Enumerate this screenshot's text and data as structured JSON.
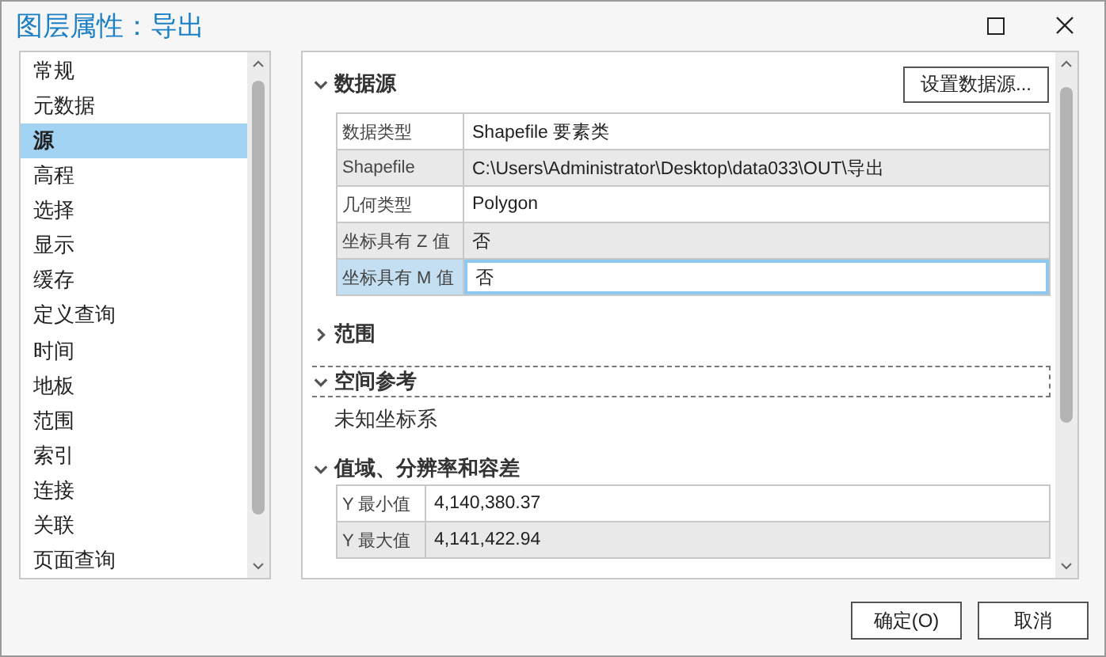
{
  "window": {
    "title": "图层属性：导出"
  },
  "sidebar": {
    "items": [
      {
        "label": "常规",
        "selected": false
      },
      {
        "label": "元数据",
        "selected": false
      },
      {
        "label": "源",
        "selected": true
      },
      {
        "label": "高程",
        "selected": false
      },
      {
        "label": "选择",
        "selected": false
      },
      {
        "label": "显示",
        "selected": false
      },
      {
        "label": "缓存",
        "selected": false
      },
      {
        "label": "定义查询",
        "selected": false
      },
      {
        "label": "时间",
        "selected": false
      },
      {
        "label": "地板",
        "selected": false
      },
      {
        "label": "范围",
        "selected": false
      },
      {
        "label": "索引",
        "selected": false
      },
      {
        "label": "连接",
        "selected": false
      },
      {
        "label": "关联",
        "selected": false
      },
      {
        "label": "页面查询",
        "selected": false
      }
    ]
  },
  "sections": [
    {
      "kind": "table",
      "title": "数据源",
      "expanded": true,
      "focused": false,
      "button": "设置数据源...",
      "rows": [
        {
          "label": "数据类型",
          "value": "Shapefile 要素类",
          "selected": false
        },
        {
          "label": "Shapefile",
          "value": "C:\\Users\\Administrator\\Desktop\\data033\\OUT\\导出",
          "selected": false
        },
        {
          "label": "几何类型",
          "value": "Polygon",
          "selected": false
        },
        {
          "label": "坐标具有 Z 值",
          "value": "否",
          "selected": false
        },
        {
          "label": "坐标具有 M 值",
          "value": "否",
          "selected": true
        }
      ]
    },
    {
      "title": "范围",
      "expanded": false,
      "focused": false
    },
    {
      "kind": "text",
      "title": "空间参考",
      "expanded": true,
      "focused": true,
      "text": "未知坐标系"
    },
    {
      "kind": "range-table",
      "title": "值域、分辨率和容差",
      "expanded": true,
      "focused": false,
      "rows": [
        {
          "label": "Y 最小值",
          "value": "4,140,380.37",
          "selected": false
        },
        {
          "label": "Y 最大值",
          "value": "4,141,422.94",
          "selected": false
        }
      ]
    }
  ],
  "buttons": [
    "确定(O)",
    "取消"
  ]
}
